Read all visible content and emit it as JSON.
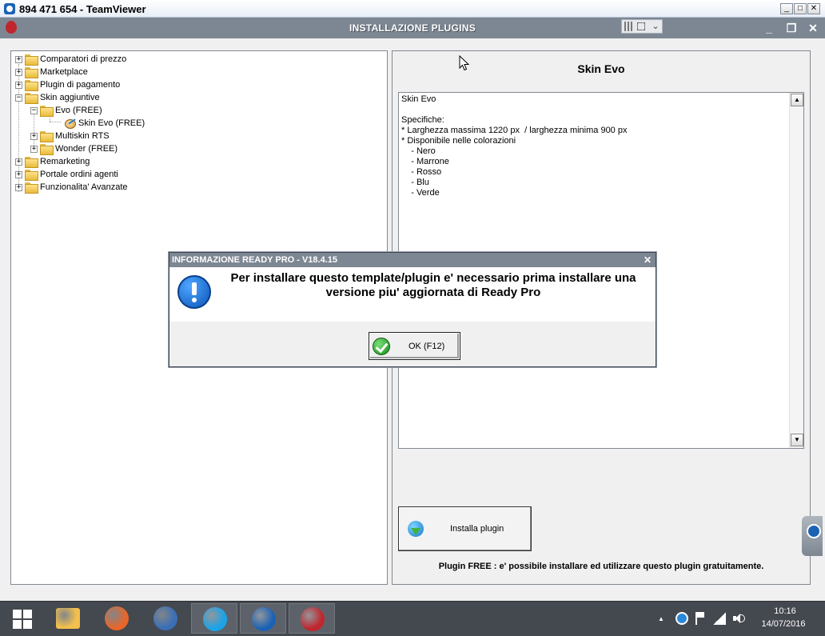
{
  "teamviewer": {
    "title": "894 471 654 - TeamViewer",
    "minimize": "_",
    "maximize": "□",
    "close": "✕"
  },
  "app": {
    "title": "INSTALLAZIONE PLUGINS",
    "minimize": "_",
    "restore": "❐",
    "close": "✕"
  },
  "tree": {
    "items": [
      {
        "label": "Comparatori di prezzo",
        "level": 0,
        "expander": "+",
        "icon": "folder-icon"
      },
      {
        "label": "Marketplace",
        "level": 0,
        "expander": "+",
        "icon": "folder-icon"
      },
      {
        "label": "Plugin di pagamento",
        "level": 0,
        "expander": "+",
        "icon": "folder-icon"
      },
      {
        "label": "Skin aggiuntive",
        "level": 0,
        "expander": "−",
        "icon": "folder-icon"
      },
      {
        "label": "Evo (FREE)",
        "level": 1,
        "expander": "−",
        "icon": "folder-icon"
      },
      {
        "label": "Skin Evo (FREE)",
        "level": 2,
        "expander": "",
        "icon": "plugin-icon"
      },
      {
        "label": "Multiskin RTS",
        "level": 1,
        "expander": "+",
        "icon": "folder-icon"
      },
      {
        "label": "Wonder (FREE)",
        "level": 1,
        "expander": "+",
        "icon": "folder-icon"
      },
      {
        "label": "Remarketing",
        "level": 0,
        "expander": "+",
        "icon": "folder-icon"
      },
      {
        "label": "Portale ordini agenti",
        "level": 0,
        "expander": "+",
        "icon": "folder-icon"
      },
      {
        "label": "Funzionalita' Avanzate",
        "level": 0,
        "expander": "+",
        "icon": "folder-icon"
      }
    ]
  },
  "detail": {
    "title": "Skin Evo",
    "description": "Skin Evo\n\nSpecifiche:\n* Larghezza massima 1220 px  / larghezza minima 900 px\n* Disponibile nelle colorazioni\n    - Nero\n    - Marrone\n    - Rosso\n    - Blu\n    - Verde",
    "scroll_up": "▲",
    "scroll_down": "▼",
    "install_label": "Installa plugin",
    "free_note": "Plugin FREE : e' possibile installare ed utilizzare questo plugin gratuitamente."
  },
  "modal": {
    "title": "INFORMAZIONE READY PRO - V18.4.15",
    "close": "✕",
    "message": "Per installare questo template/plugin e' necessario prima installare una versione piu' aggiornata di Ready Pro",
    "ok_label": "OK (F12)"
  },
  "taskbar": {
    "apps": [
      {
        "name": "file-explorer",
        "icon": "folder-icon",
        "color": "#f2c04c",
        "active": false
      },
      {
        "name": "firefox",
        "icon": "firefox-icon",
        "color": "#e8662a",
        "active": false
      },
      {
        "name": "thunderbird",
        "icon": "thunderbird-icon",
        "color": "#3a6fb5",
        "active": false
      },
      {
        "name": "skype",
        "icon": "skype-icon",
        "color": "#1aa3e8",
        "active": true
      },
      {
        "name": "teamviewer",
        "icon": "teamviewer-icon",
        "color": "#1b62b5",
        "active": true
      },
      {
        "name": "ready-pro",
        "icon": "strawberry-icon",
        "color": "#c0262d",
        "active": true
      }
    ],
    "tray_arrow": "▲",
    "clock_time": "10:16",
    "clock_date": "14/07/2016"
  }
}
